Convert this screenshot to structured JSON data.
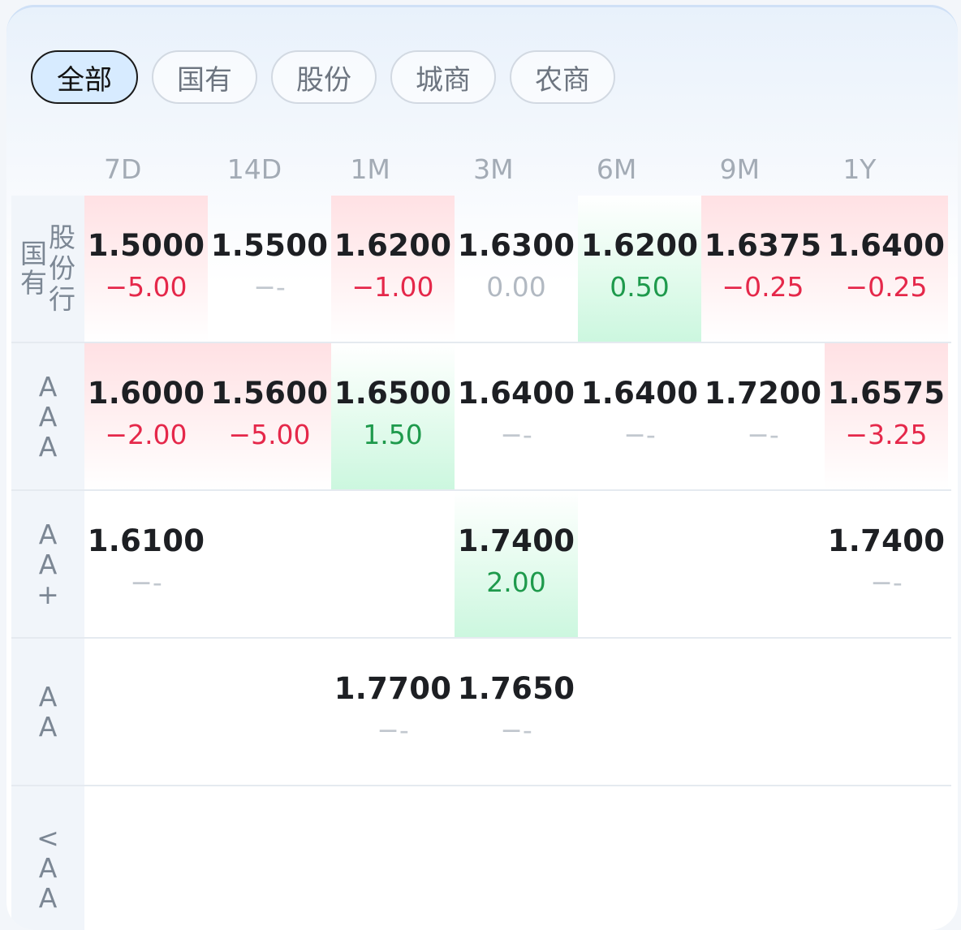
{
  "filters": [
    "全部",
    "国有",
    "股份",
    "城商",
    "农商"
  ],
  "periods": [
    "7D",
    "14D",
    "1M",
    "3M",
    "6M",
    "9M",
    "1Y"
  ],
  "rows": [
    {
      "label_left": [
        "国",
        "有"
      ],
      "label_right": [
        "股",
        "份",
        "行"
      ],
      "cells": [
        {
          "rate": "1.5000",
          "change": "-5.00",
          "trend": "neg",
          "bg": "red"
        },
        {
          "rate": "1.5500",
          "change": "--",
          "trend": "none",
          "bg": ""
        },
        {
          "rate": "1.6200",
          "change": "-1.00",
          "trend": "neg",
          "bg": "red"
        },
        {
          "rate": "1.6300",
          "change": "0.00",
          "trend": "flat",
          "bg": ""
        },
        {
          "rate": "1.6200",
          "change": "0.50",
          "trend": "pos",
          "bg": "green"
        },
        {
          "rate": "1.6375",
          "change": "-0.25",
          "trend": "neg",
          "bg": "red"
        },
        {
          "rate": "1.6400",
          "change": "-0.25",
          "trend": "neg",
          "bg": "red"
        }
      ]
    },
    {
      "label": [
        "A",
        "A",
        "A"
      ],
      "cells": [
        {
          "rate": "1.6000",
          "change": "-2.00",
          "trend": "neg",
          "bg": "red"
        },
        {
          "rate": "1.5600",
          "change": "-5.00",
          "trend": "neg",
          "bg": "red"
        },
        {
          "rate": "1.6500",
          "change": "1.50",
          "trend": "pos",
          "bg": "green"
        },
        {
          "rate": "1.6400",
          "change": "--",
          "trend": "none",
          "bg": ""
        },
        {
          "rate": "1.6400",
          "change": "--",
          "trend": "none",
          "bg": ""
        },
        {
          "rate": "1.7200",
          "change": "--",
          "trend": "none",
          "bg": ""
        },
        {
          "rate": "1.6575",
          "change": "-3.25",
          "trend": "neg",
          "bg": "red"
        }
      ]
    },
    {
      "label": [
        "A",
        "A",
        "+"
      ],
      "cells": [
        {
          "rate": "1.6100",
          "change": "--",
          "trend": "none",
          "bg": ""
        },
        {
          "rate": "",
          "change": "",
          "trend": "",
          "bg": ""
        },
        {
          "rate": "",
          "change": "",
          "trend": "",
          "bg": ""
        },
        {
          "rate": "1.7400",
          "change": "2.00",
          "trend": "pos",
          "bg": "green"
        },
        {
          "rate": "",
          "change": "",
          "trend": "",
          "bg": ""
        },
        {
          "rate": "",
          "change": "",
          "trend": "",
          "bg": ""
        },
        {
          "rate": "1.7400",
          "change": "--",
          "trend": "none",
          "bg": ""
        }
      ]
    },
    {
      "label": [
        "A",
        "A"
      ],
      "cells": [
        {
          "rate": "",
          "change": "",
          "trend": "",
          "bg": ""
        },
        {
          "rate": "",
          "change": "",
          "trend": "",
          "bg": ""
        },
        {
          "rate": "1.7700",
          "change": "--",
          "trend": "none",
          "bg": ""
        },
        {
          "rate": "1.7650",
          "change": "--",
          "trend": "none",
          "bg": ""
        },
        {
          "rate": "",
          "change": "",
          "trend": "",
          "bg": ""
        },
        {
          "rate": "",
          "change": "",
          "trend": "",
          "bg": ""
        },
        {
          "rate": "",
          "change": "",
          "trend": "",
          "bg": ""
        }
      ]
    },
    {
      "label": [
        "<",
        "A",
        "A"
      ],
      "cells": [
        {
          "rate": "",
          "change": "",
          "trend": "",
          "bg": ""
        },
        {
          "rate": "",
          "change": "",
          "trend": "",
          "bg": ""
        },
        {
          "rate": "",
          "change": "",
          "trend": "",
          "bg": ""
        },
        {
          "rate": "",
          "change": "",
          "trend": "",
          "bg": ""
        },
        {
          "rate": "",
          "change": "",
          "trend": "",
          "bg": ""
        },
        {
          "rate": "",
          "change": "",
          "trend": "",
          "bg": ""
        },
        {
          "rate": "",
          "change": "",
          "trend": "",
          "bg": ""
        }
      ]
    }
  ],
  "colors": {
    "negative": "#e5284a",
    "positive": "#1e9a4c",
    "active_chip_bg": "#d7ebff"
  }
}
